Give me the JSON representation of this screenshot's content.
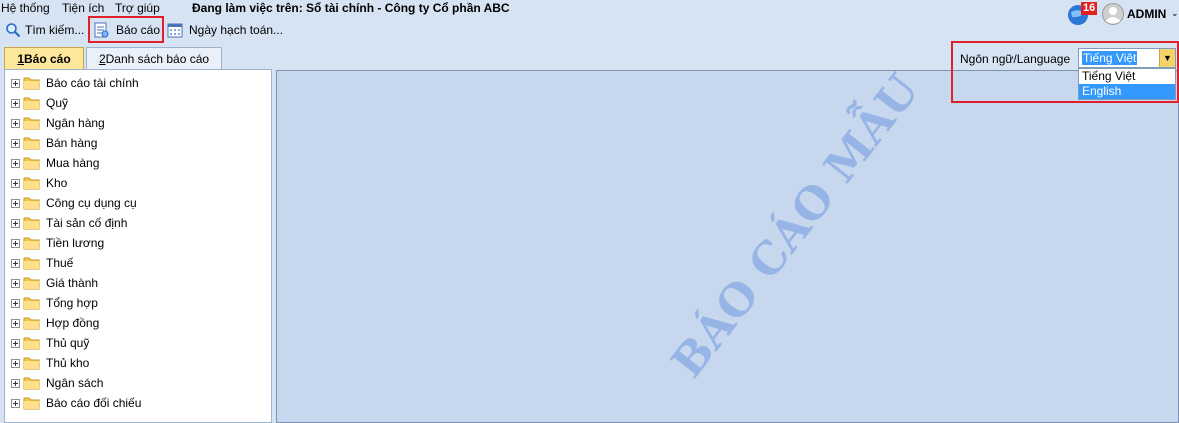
{
  "menu": {
    "items": [
      "Hệ thống",
      "Tiện ích",
      "Trợ giúp"
    ],
    "working_on": "Đang làm việc trên: Sổ tài chính - Công ty Cổ phần ABC"
  },
  "toolbar": {
    "search_label": "Tìm kiếm...",
    "report_label": "Báo cáo",
    "posting_date_label": "Ngày hạch toán..."
  },
  "user": {
    "notification_count": "16",
    "name": "ADMIN"
  },
  "tabs": [
    {
      "key": "1",
      "label": " Báo cáo",
      "active": true
    },
    {
      "key": "2",
      "label": " Danh sách báo cáo",
      "active": false
    }
  ],
  "tree": {
    "items": [
      "Báo cáo tài chính",
      "Quỹ",
      "Ngân hàng",
      "Bán hàng",
      "Mua hàng",
      "Kho",
      "Công cụ dụng cụ",
      "Tài sản cố định",
      "Tiền lương",
      "Thuế",
      "Giá thành",
      "Tổng hợp",
      "Hợp đồng",
      "Thủ quỹ",
      "Thủ kho",
      "Ngân sách",
      "Báo cáo đối chiếu"
    ]
  },
  "preview": {
    "watermark": "BÁO CÁO MẪU"
  },
  "language": {
    "label": "Ngôn ngữ/Language",
    "selected": "Tiếng Việt",
    "options": [
      "Tiếng Việt",
      "English"
    ],
    "highlighted_option": "English"
  },
  "colors": {
    "highlight_border": "#e0202a",
    "selection": "#3399ff",
    "folder": "#f3c94d"
  }
}
